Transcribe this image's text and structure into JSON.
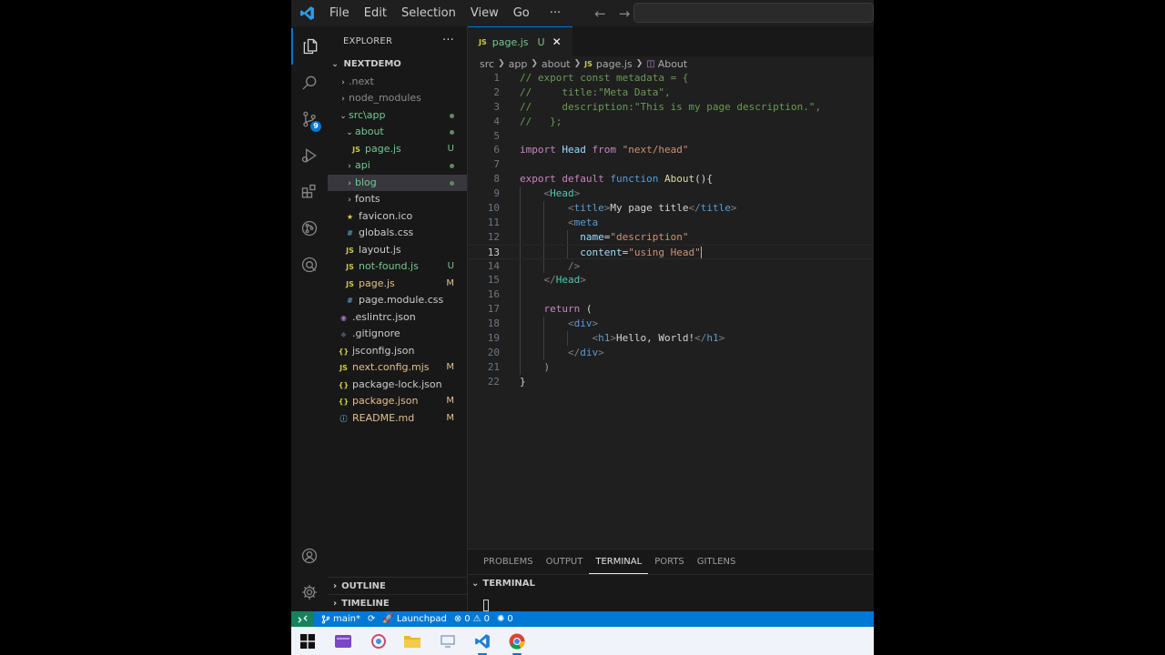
{
  "titlebar": {
    "menu": [
      "File",
      "Edit",
      "Selection",
      "View",
      "Go",
      "···"
    ]
  },
  "activitybar": {
    "scm_badge": "9"
  },
  "sidebar": {
    "title": "EXPLORER",
    "more": "···",
    "project": "NEXTDEMO",
    "items": [
      {
        "label": ".next",
        "chev": "›",
        "depth": 1,
        "color": "#8b8b8b"
      },
      {
        "label": "node_modules",
        "chev": "›",
        "depth": 1,
        "color": "#8b8b8b"
      },
      {
        "label": "src\\app",
        "chev": "⌄",
        "depth": 1,
        "color": "#73c991",
        "dot": "#5e8a64"
      },
      {
        "label": "about",
        "chev": "⌄",
        "depth": 2,
        "color": "#73c991",
        "dot": "#5e8a64"
      },
      {
        "label": "page.js",
        "icon": "JS",
        "iconColor": "#cbcb41",
        "depth": 3,
        "color": "#73c991",
        "status": "U",
        "statusColor": "#73c991"
      },
      {
        "label": "api",
        "chev": "›",
        "depth": 2,
        "color": "#73c991",
        "dot": "#5e8a64"
      },
      {
        "label": "blog",
        "chev": "›",
        "depth": 2,
        "color": "#73c991",
        "dot": "#5e8a64",
        "selected": true
      },
      {
        "label": "fonts",
        "chev": "›",
        "depth": 2,
        "color": "#cccccc"
      },
      {
        "label": "favicon.ico",
        "icon": "★",
        "iconColor": "#e8d44d",
        "depth": 2,
        "color": "#cccccc"
      },
      {
        "label": "globals.css",
        "icon": "#",
        "iconColor": "#519aba",
        "depth": 2,
        "color": "#cccccc"
      },
      {
        "label": "layout.js",
        "icon": "JS",
        "iconColor": "#cbcb41",
        "depth": 2,
        "color": "#cccccc"
      },
      {
        "label": "not-found.js",
        "icon": "JS",
        "iconColor": "#cbcb41",
        "depth": 2,
        "color": "#73c991",
        "status": "U",
        "statusColor": "#73c991"
      },
      {
        "label": "page.js",
        "icon": "JS",
        "iconColor": "#cbcb41",
        "depth": 2,
        "color": "#e2c08d",
        "status": "M",
        "statusColor": "#e2c08d"
      },
      {
        "label": "page.module.css",
        "icon": "#",
        "iconColor": "#519aba",
        "depth": 2,
        "color": "#cccccc"
      },
      {
        "label": ".eslintrc.json",
        "icon": "◉",
        "iconColor": "#a074c4",
        "depth": 1,
        "color": "#cccccc"
      },
      {
        "label": ".gitignore",
        "icon": "◆",
        "iconColor": "#41535b",
        "depth": 1,
        "color": "#cccccc"
      },
      {
        "label": "jsconfig.json",
        "icon": "{}",
        "iconColor": "#cbcb41",
        "depth": 1,
        "color": "#cccccc"
      },
      {
        "label": "next.config.mjs",
        "icon": "JS",
        "iconColor": "#cbcb41",
        "depth": 1,
        "color": "#e2c08d",
        "status": "M",
        "statusColor": "#e2c08d"
      },
      {
        "label": "package-lock.json",
        "icon": "{}",
        "iconColor": "#cbcb41",
        "depth": 1,
        "color": "#cccccc"
      },
      {
        "label": "package.json",
        "icon": "{}",
        "iconColor": "#cbcb41",
        "depth": 1,
        "color": "#e2c08d",
        "status": "M",
        "statusColor": "#e2c08d"
      },
      {
        "label": "README.md",
        "icon": "ⓘ",
        "iconColor": "#519aba",
        "depth": 1,
        "color": "#e2c08d",
        "status": "M",
        "statusColor": "#e2c08d"
      }
    ],
    "outline": "OUTLINE",
    "timeline": "TIMELINE"
  },
  "editor": {
    "tab": {
      "icon": "JS",
      "label": "page.js",
      "status": "U",
      "close": "✕"
    },
    "breadcrumbs": [
      "src",
      "app",
      "about",
      "page.js",
      "About"
    ],
    "current_line": 13,
    "lines": [
      [
        [
          "t-comment",
          "// export const metadata = {"
        ]
      ],
      [
        [
          "t-comment",
          "//     title:\"Meta Data\","
        ]
      ],
      [
        [
          "t-comment",
          "//     description:\"This is my page description.\","
        ]
      ],
      [
        [
          "t-comment",
          "//   };"
        ]
      ],
      [],
      [
        [
          "t-ctrl",
          "import"
        ],
        [
          "t-text",
          " "
        ],
        [
          "t-var",
          "Head"
        ],
        [
          "t-text",
          " "
        ],
        [
          "t-ctrl",
          "from"
        ],
        [
          "t-text",
          " "
        ],
        [
          "t-str",
          "\"next/head\""
        ]
      ],
      [],
      [
        [
          "t-ctrl",
          "export"
        ],
        [
          "t-text",
          " "
        ],
        [
          "t-ctrl",
          "default"
        ],
        [
          "t-text",
          " "
        ],
        [
          "t-kw",
          "function"
        ],
        [
          "t-text",
          " "
        ],
        [
          "t-fn",
          "About"
        ],
        [
          "t-text",
          "(){"
        ]
      ],
      [
        [
          "t-text",
          "    "
        ],
        [
          "t-punc",
          "<"
        ],
        [
          "t-comp",
          "Head"
        ],
        [
          "t-punc",
          ">"
        ]
      ],
      [
        [
          "t-text",
          "        "
        ],
        [
          "t-punc",
          "<"
        ],
        [
          "t-tag",
          "title"
        ],
        [
          "t-punc",
          ">"
        ],
        [
          "t-text",
          "My page title"
        ],
        [
          "t-punc",
          "</"
        ],
        [
          "t-tag",
          "title"
        ],
        [
          "t-punc",
          ">"
        ]
      ],
      [
        [
          "t-text",
          "        "
        ],
        [
          "t-punc",
          "<"
        ],
        [
          "t-tag",
          "meta"
        ]
      ],
      [
        [
          "t-text",
          "          "
        ],
        [
          "t-attr",
          "name"
        ],
        [
          "t-text",
          "="
        ],
        [
          "t-str",
          "\"description\""
        ]
      ],
      [
        [
          "t-text",
          "          "
        ],
        [
          "t-attr",
          "content"
        ],
        [
          "t-text",
          "="
        ],
        [
          "t-str",
          "\"using Head\""
        ]
      ],
      [
        [
          "t-text",
          "        "
        ],
        [
          "t-punc",
          "/>"
        ]
      ],
      [
        [
          "t-text",
          "    "
        ],
        [
          "t-punc",
          "</"
        ],
        [
          "t-comp",
          "Head"
        ],
        [
          "t-punc",
          ">"
        ]
      ],
      [],
      [
        [
          "t-text",
          "    "
        ],
        [
          "t-ctrl",
          "return"
        ],
        [
          "t-text",
          " ("
        ]
      ],
      [
        [
          "t-text",
          "        "
        ],
        [
          "t-punc",
          "<"
        ],
        [
          "t-tag",
          "div"
        ],
        [
          "t-punc",
          ">"
        ]
      ],
      [
        [
          "t-text",
          "            "
        ],
        [
          "t-punc",
          "<"
        ],
        [
          "t-tag",
          "h1"
        ],
        [
          "t-punc",
          ">"
        ],
        [
          "t-text",
          "Hello, World!"
        ],
        [
          "t-punc",
          "</"
        ],
        [
          "t-tag",
          "h1"
        ],
        [
          "t-punc",
          ">"
        ]
      ],
      [
        [
          "t-text",
          "        "
        ],
        [
          "t-punc",
          "</"
        ],
        [
          "t-tag",
          "div"
        ],
        [
          "t-punc",
          ">"
        ]
      ],
      [
        [
          "t-text",
          "    "
        ],
        [
          "t-ctrl",
          ")"
        ]
      ],
      [
        [
          "t-text",
          "}"
        ]
      ]
    ]
  },
  "panel": {
    "tabs": [
      "PROBLEMS",
      "OUTPUT",
      "TERMINAL",
      "PORTS",
      "GITLENS"
    ],
    "active_tab": "TERMINAL",
    "section": "TERMINAL"
  },
  "statusbar": {
    "branch": "main*",
    "launchpad": "Launchpad",
    "errors": "0",
    "warnings": "0",
    "ports": "0"
  },
  "colors": {
    "accent": "#0078d4",
    "status_bar": "#0078d4",
    "remote": "#16825d",
    "untracked": "#73c991",
    "modified": "#e2c08d"
  }
}
